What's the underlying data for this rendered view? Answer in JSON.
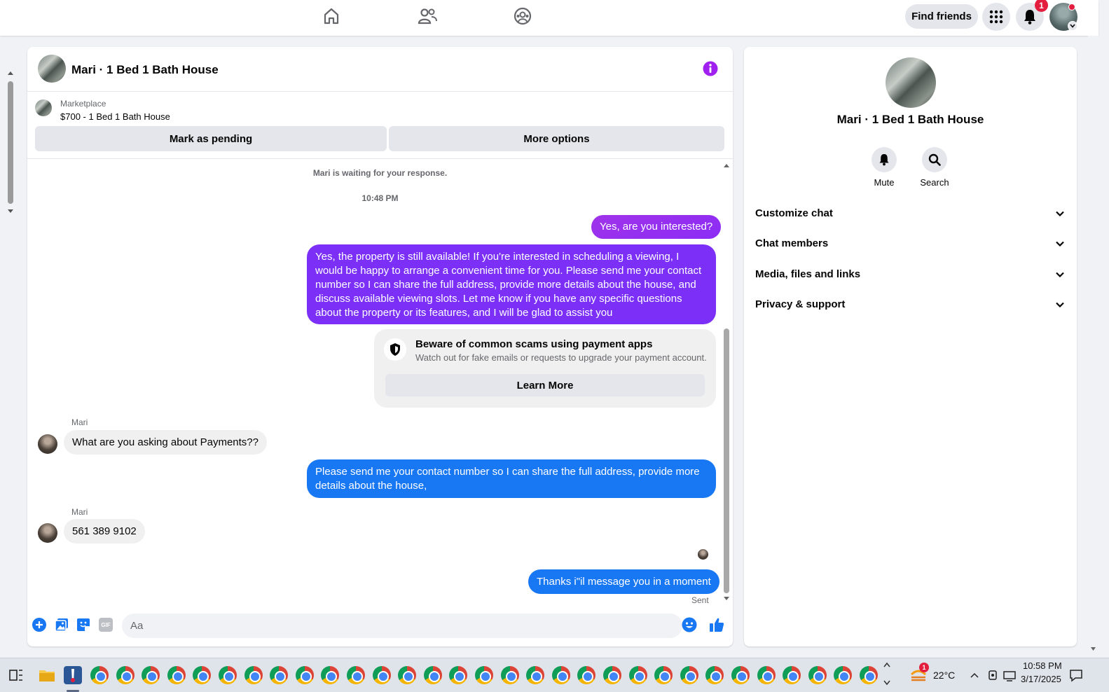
{
  "topnav": {
    "find_friends_label": "Find friends",
    "notification_count": "1"
  },
  "chat": {
    "title": "Mari · 1 Bed 1 Bath House",
    "marketplace_label": "Marketplace",
    "listing": "$700 - 1 Bed 1 Bath House",
    "mark_pending_label": "Mark as pending",
    "more_options_label": "More options",
    "waiting_note": "Mari is waiting for your response.",
    "timestamp": "10:48 PM",
    "messages": [
      {
        "from": "me",
        "text": "Yes, are you interested?"
      },
      {
        "from": "me",
        "text": "Yes, the property is still available! If you're interested in scheduling a viewing, I would be happy to arrange a convenient time for you. Please send me your contact number so I can share the full address, provide more details about the house, and discuss available viewing slots. Let me know if you have any specific questions about the property or its features, and I will be glad to assist you"
      },
      {
        "from": "Mari",
        "sender": "Mari",
        "text": "What are you asking about Payments??"
      },
      {
        "from": "me",
        "text": "Please send me your contact number so I can share the full address, provide more details about the house,"
      },
      {
        "from": "Mari",
        "sender": "Mari",
        "text": "561 389 9102"
      },
      {
        "from": "me",
        "text": "Thanks i\"il message you in a moment"
      }
    ],
    "scam_notice": {
      "title": "Beware of common scams using payment apps",
      "subtitle": "Watch out for fake emails or requests to upgrade your payment account.",
      "button_label": "Learn More"
    },
    "sent_status": "Sent",
    "composer_placeholder": "Aa",
    "composer_gif_label": "GIF"
  },
  "side": {
    "name": "Mari · 1 Bed 1 Bath House",
    "actions": [
      {
        "label": "Mute",
        "icon": "bell-icon"
      },
      {
        "label": "Search",
        "icon": "search-icon"
      }
    ],
    "sections": [
      {
        "label": "Customize chat"
      },
      {
        "label": "Chat members"
      },
      {
        "label": "Media, files and links"
      },
      {
        "label": "Privacy & support"
      }
    ]
  },
  "taskbar": {
    "temperature": "22°C",
    "weather_badge": "1",
    "time": "10:58 PM",
    "date": "3/17/2025"
  },
  "colors": {
    "accent_blue": "#1877f2",
    "bubble_purple": "#9333ea",
    "bubble_violet": "#7b2ff7",
    "info_purple": "#a020f0"
  }
}
